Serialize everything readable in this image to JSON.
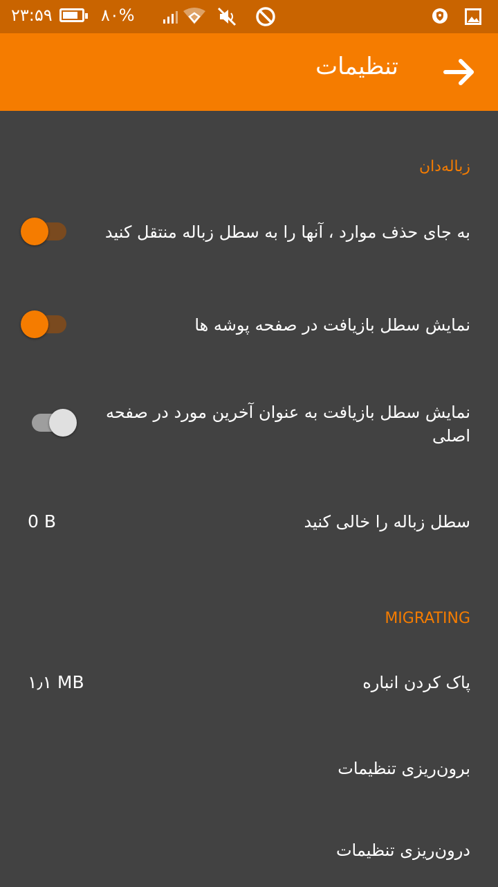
{
  "status_bar": {
    "time": "۲۳:۵۹",
    "battery_percent": "۸۰%",
    "battery_level": 0.8,
    "icons": [
      "battery-icon",
      "signal-icon",
      "wifi-icon",
      "mute-icon",
      "do-not-disturb-icon",
      "shield-icon",
      "image-icon"
    ]
  },
  "app_bar": {
    "title": "تنظیمات",
    "back_icon": "arrow-right-icon",
    "color": "#f57c00"
  },
  "sections": {
    "trash": {
      "header": "زباله‌دان",
      "items": {
        "move_to_trash": {
          "label": "به جای حذف موارد ، آنها را به سطل زباله منتقل کنید",
          "enabled": true
        },
        "show_recycle_in_folders": {
          "label": "نمایش سطل بازیافت در صفحه پوشه ها",
          "enabled": true
        },
        "show_recycle_last_item": {
          "label": "نمایش سطل بازیافت به عنوان آخرین مورد در صفحه اصلی",
          "enabled": false
        },
        "empty_trash": {
          "label": "سطل زباله را خالی کنید",
          "value": "0 B"
        }
      }
    },
    "migrating": {
      "header": "MIGRATING",
      "items": {
        "clear_cache": {
          "label": "پاک کردن انباره",
          "value": "۱٫۱ MB"
        },
        "export_settings": {
          "label": "برون‌ریزی تنظیمات"
        },
        "import_settings": {
          "label": "درون‌ریزی تنظیمات"
        }
      }
    }
  },
  "colors": {
    "accent": "#f57c00",
    "status_bar": "#c96400",
    "background": "#424242",
    "toggle_on_track": "#7a4a1f",
    "toggle_off_track": "#9e9e9e",
    "toggle_off_thumb": "#e0e0e0"
  }
}
